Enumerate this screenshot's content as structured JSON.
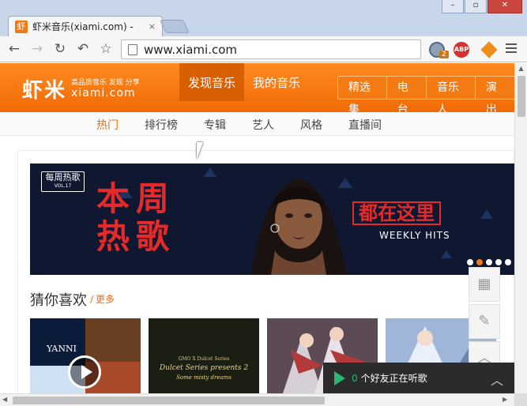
{
  "browser": {
    "tab": {
      "title": "虾米音乐(xiami.com) -",
      "favicon": "虾",
      "close": "×"
    },
    "window_controls": {
      "minimize": "–",
      "maximize": "▫",
      "close": "✕"
    },
    "nav": {
      "back": "←",
      "forward": "→",
      "reload": "↻",
      "undo": "↶",
      "star": "☆"
    },
    "url": "www.xiami.com",
    "extensions": {
      "badge": "2",
      "abp": "ABP"
    }
  },
  "site": {
    "logo": {
      "cn": "虾米",
      "tagline": "高品质音乐 发现 分享",
      "en": "xiami.com"
    },
    "main_nav": [
      "发现音乐",
      "我的音乐"
    ],
    "channels": [
      "精选集",
      "电台",
      "音乐人",
      "演出"
    ],
    "sub_nav": [
      "热门",
      "排行榜",
      "专辑",
      "艺人",
      "风格",
      "直播间"
    ],
    "banner": {
      "badge_title": "每周热歌",
      "badge_vol": "VOL.17",
      "line1": "本周",
      "line2": "热歌",
      "here": "都在这里",
      "english": "WEEKLY HITS",
      "dot_count": 5,
      "active_dot": 1
    },
    "section": {
      "title": "猜你喜欢",
      "more": "更多"
    },
    "albums": [
      {
        "label": "YANNI"
      },
      {
        "label": "GMO X Dulcet Series",
        "sub": "Dulcet Series presents 2",
        "sub2": "Some misty dreams"
      },
      {
        "label": ""
      },
      {
        "label": ""
      }
    ],
    "friends_bar": {
      "count": "0",
      "label": "个好友正在听歌",
      "toggle": "︿"
    }
  },
  "colors": {
    "brand_orange": "#f47a13",
    "accent_green": "#2bb673",
    "banner_red": "#e42a2a"
  }
}
